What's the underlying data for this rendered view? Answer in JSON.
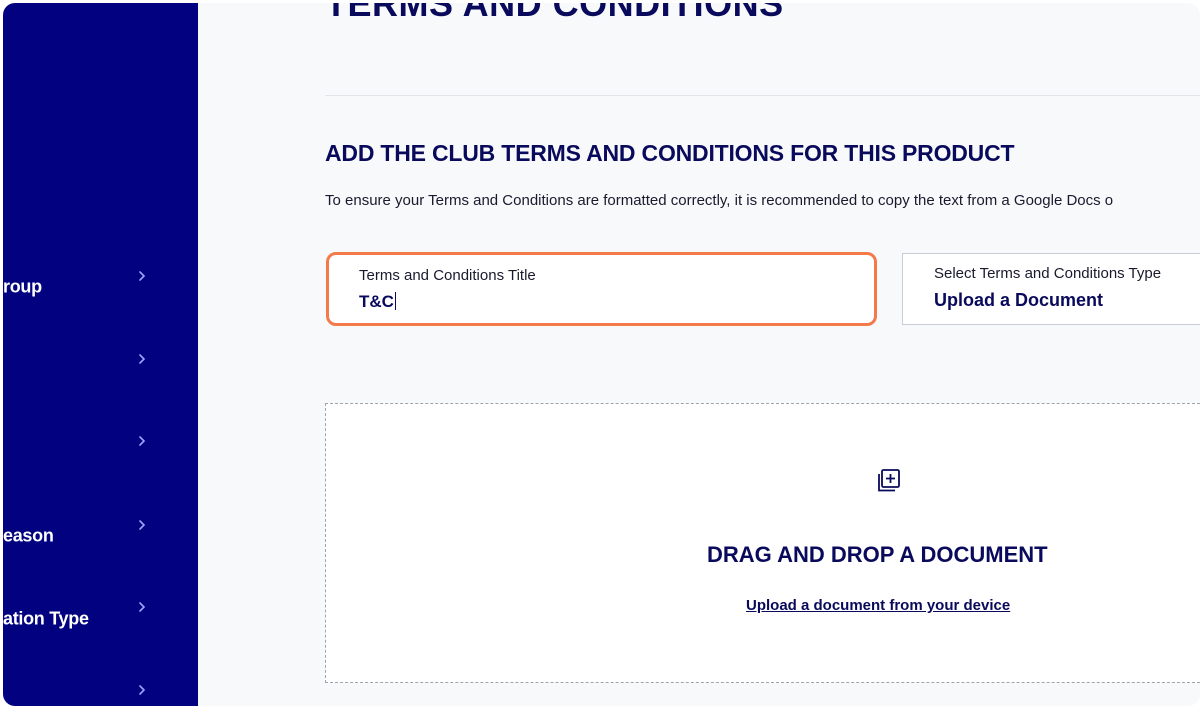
{
  "sidebar": {
    "items": [
      {
        "label": "Group",
        "chevron": "chevron-right-icon"
      },
      {
        "label": "",
        "chevron": "chevron-right-icon"
      },
      {
        "label": "",
        "chevron": "chevron-right-icon"
      },
      {
        "label": "Season",
        "chevron": "chevron-right-icon"
      },
      {
        "label": "Registration Type",
        "chevron": "chevron-right-icon"
      },
      {
        "label": "",
        "chevron": "chevron-right-icon"
      }
    ],
    "visible_labels": [
      "roup",
      "eason",
      "ation Type"
    ]
  },
  "page": {
    "title": "TERMS AND CONDITIONS"
  },
  "section": {
    "heading": "ADD THE CLUB TERMS AND CONDITIONS FOR THIS PRODUCT",
    "helper": "To ensure your Terms and Conditions are formatted correctly, it is recommended to copy the text from a Google Docs o"
  },
  "form": {
    "title_field": {
      "label": "Terms and Conditions Title",
      "value": "T&C"
    },
    "type_field": {
      "label": "Select Terms and Conditions Type",
      "value": "Upload a Document"
    }
  },
  "dropzone": {
    "icon": "add-document-icon",
    "title": "DRAG AND DROP A DOCUMENT",
    "link": "Upload a document from your device"
  },
  "colors": {
    "sidebar_bg": "#020280",
    "primary_text": "#0a0a5c",
    "focus_outline": "#f47a4a",
    "page_bg": "#f8f9fb"
  }
}
